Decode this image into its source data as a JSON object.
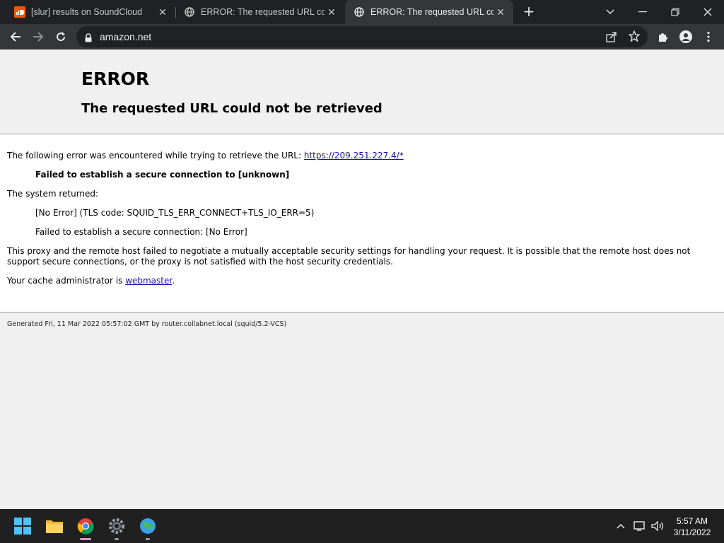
{
  "browser": {
    "tabs": [
      {
        "title": "[slur] results on SoundCloud",
        "favicon": "soundcloud-icon",
        "active": false
      },
      {
        "title": "ERROR: The requested URL could not be retrieved",
        "favicon": "globe-icon",
        "active": false
      },
      {
        "title": "ERROR: The requested URL could not be retrieved",
        "favicon": "globe-icon",
        "active": true
      }
    ],
    "url": "amazon.net"
  },
  "page": {
    "title": "ERROR",
    "subtitle": "The requested URL could not be retrieved",
    "intro": "The following error was encountered while trying to retrieve the URL: ",
    "error_url": "https://209.251.227.4/*",
    "error_detail": "Failed to establish a secure connection to [unknown]",
    "system_returned": "The system returned:",
    "tls_code": "[No Error] (TLS code: SQUID_TLS_ERR_CONNECT+TLS_IO_ERR=5)",
    "secure_connection": "Failed to establish a secure connection: [No Error]",
    "explanation": "This proxy and the remote host failed to negotiate a mutually acceptable security settings for handling your request. It is possible that the remote host does not support secure connections, or the proxy is not satisfied with the host security credentials.",
    "admin_prefix": "Your cache administrator is ",
    "admin_link": "webmaster",
    "admin_suffix": ".",
    "footer": "Generated Fri, 11 Mar 2022 05:57:02 GMT by router.collabnet.local (squid/5.2-VCS)"
  },
  "taskbar": {
    "time": "5:57 AM",
    "date": "3/11/2022",
    "apps": [
      "windows-start-icon",
      "file-explorer-icon",
      "chrome-icon",
      "settings-icon",
      "maps-icon"
    ]
  },
  "colors": {
    "tabstrip": "#202124",
    "toolbar": "#35363a",
    "link": "#1a0dab",
    "soundcloud": "#ff5500",
    "taskbar": "#202020"
  }
}
